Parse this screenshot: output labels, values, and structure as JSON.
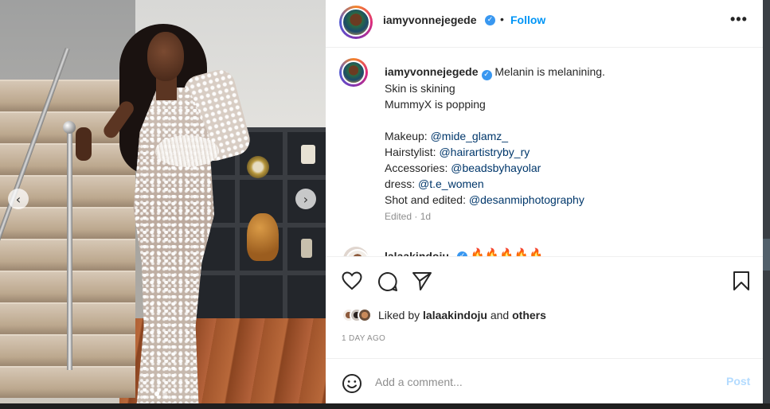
{
  "post": {
    "nav_prev": "‹",
    "nav_next": "›",
    "carousel_dots": 2
  },
  "header": {
    "username": "iamyvonnejegede",
    "verified_mark": "✓",
    "separator": "•",
    "follow_label": "Follow",
    "more_label": "•••"
  },
  "caption": {
    "username": "iamyvonnejegede",
    "lines": [
      "Melanin is melanining.",
      "Skin is skining",
      "MummyX is popping"
    ],
    "credits": [
      {
        "label": "Makeup: ",
        "mention": "@mide_glamz_"
      },
      {
        "label": "Hairstylist: ",
        "mention": "@hairartistryby_ry"
      },
      {
        "label": "Accessories: ",
        "mention": "@beadsbyhayolar"
      },
      {
        "label": "dress: ",
        "mention": "@t.e_women"
      },
      {
        "label": "Shot and edited: ",
        "mention": "@desanmiphotography"
      }
    ],
    "meta": "Edited · 1d"
  },
  "first_comment": {
    "username": "lalaakindoju",
    "text": "🔥🔥🔥🔥🔥"
  },
  "likes": {
    "prefix": "Liked by ",
    "user": "lalaakindoju",
    "middle": " and ",
    "others": "others"
  },
  "timestamp": "1 DAY AGO",
  "comment_box": {
    "placeholder": "Add a comment...",
    "post_label": "Post"
  },
  "icons": {
    "like": "heart-icon",
    "comment": "comment-icon",
    "share": "share-icon",
    "save": "bookmark-icon",
    "emoji": "emoji-icon"
  },
  "colors": {
    "follow": "#0095f6",
    "mention": "#00376b",
    "muted": "#8e8e8e",
    "post_disabled": "#b3dbff"
  }
}
